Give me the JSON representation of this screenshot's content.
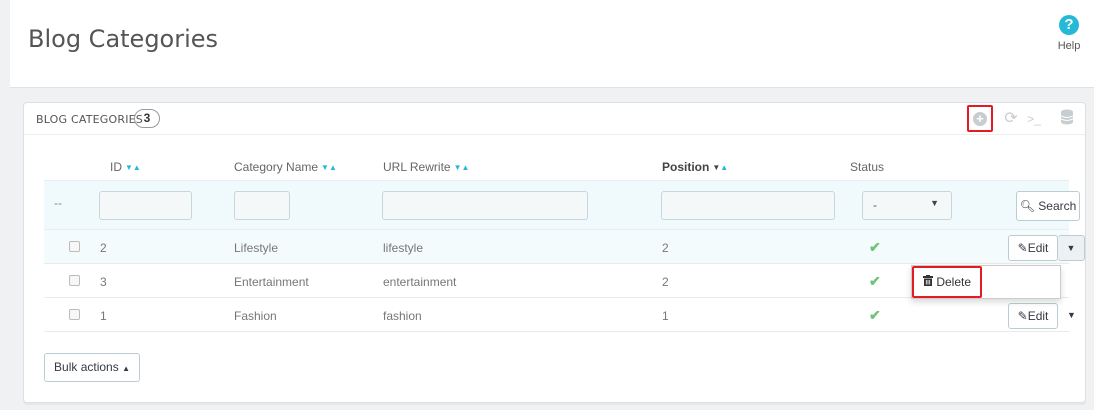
{
  "header": {
    "title": "Blog Categories",
    "help_label": "Help"
  },
  "panel": {
    "title": "BLOG CATEGORIES",
    "count": "3",
    "toolbar": [
      "add-new-icon",
      "refresh-icon",
      "sql-query-icon",
      "export-database-icon"
    ]
  },
  "table": {
    "columns": {
      "id": "ID",
      "name": "Category Name",
      "url": "URL Rewrite",
      "position": "Position",
      "status": "Status"
    },
    "filters": {
      "row_placeholder": "--",
      "status_value": "-",
      "search_label": "Search"
    },
    "rows": [
      {
        "id": "2",
        "name": "Lifestyle",
        "url": "lifestyle",
        "position": "2",
        "status": "enabled"
      },
      {
        "id": "3",
        "name": "Entertainment",
        "url": "entertainment",
        "position": "2",
        "status": "enabled"
      },
      {
        "id": "1",
        "name": "Fashion",
        "url": "fashion",
        "position": "1",
        "status": "enabled"
      }
    ],
    "edit_label": "Edit",
    "delete_label": "Delete"
  },
  "bulk_actions_label": "Bulk actions",
  "colors": {
    "accent": "#25b9d7",
    "highlight": "#e31b23",
    "status_ok": "#72c279"
  }
}
